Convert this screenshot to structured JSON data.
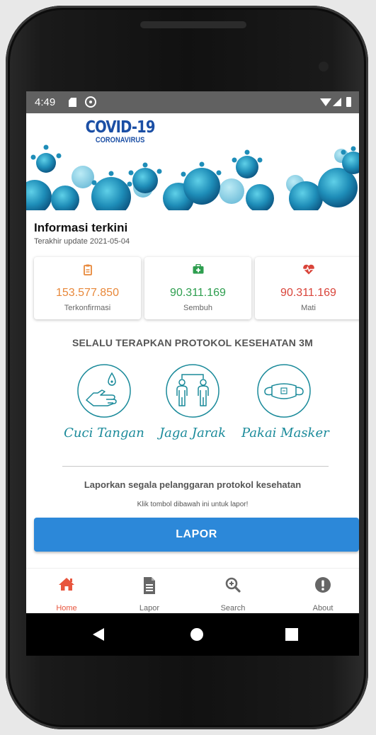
{
  "status_bar": {
    "time": "4:49"
  },
  "banner": {
    "title": "COVID-19",
    "subtitle": "CORONAVIRUS"
  },
  "info": {
    "title": "Informasi terkini",
    "updated": "Terakhir update 2021-05-04"
  },
  "stats": [
    {
      "value": "153.577.850",
      "label": "Terkonfirmasi",
      "color": "#e8883a",
      "icon": "clipboard-icon"
    },
    {
      "value": "90.311.169",
      "label": "Sembuh",
      "color": "#2e9e4f",
      "icon": "medkit-icon"
    },
    {
      "value": "90.311.169",
      "label": "Mati",
      "color": "#d9443a",
      "icon": "heartbeat-icon"
    }
  ],
  "protocol": {
    "heading": "SELALU TERAPKAN PROTOKOL KESEHATAN 3M",
    "items": [
      {
        "label": "Cuci Tangan",
        "icon": "hand-wash-icon"
      },
      {
        "label": "Jaga Jarak",
        "icon": "distance-icon"
      },
      {
        "label": "Pakai Masker",
        "icon": "mask-icon"
      }
    ],
    "accent": "#1a8a9a"
  },
  "report": {
    "text": "Laporkan segala pelanggaran protokol kesehatan",
    "hint": "Klik tombol dibawah ini untuk lapor!",
    "button": "LAPOR",
    "button_color": "#2c88d9"
  },
  "nav": {
    "items": [
      {
        "label": "Home",
        "icon": "home-icon",
        "active": true
      },
      {
        "label": "Lapor",
        "icon": "document-icon",
        "active": false
      },
      {
        "label": "Search",
        "icon": "search-icon",
        "active": false
      },
      {
        "label": "About",
        "icon": "info-icon",
        "active": false
      }
    ],
    "active_color": "#e8553d"
  }
}
